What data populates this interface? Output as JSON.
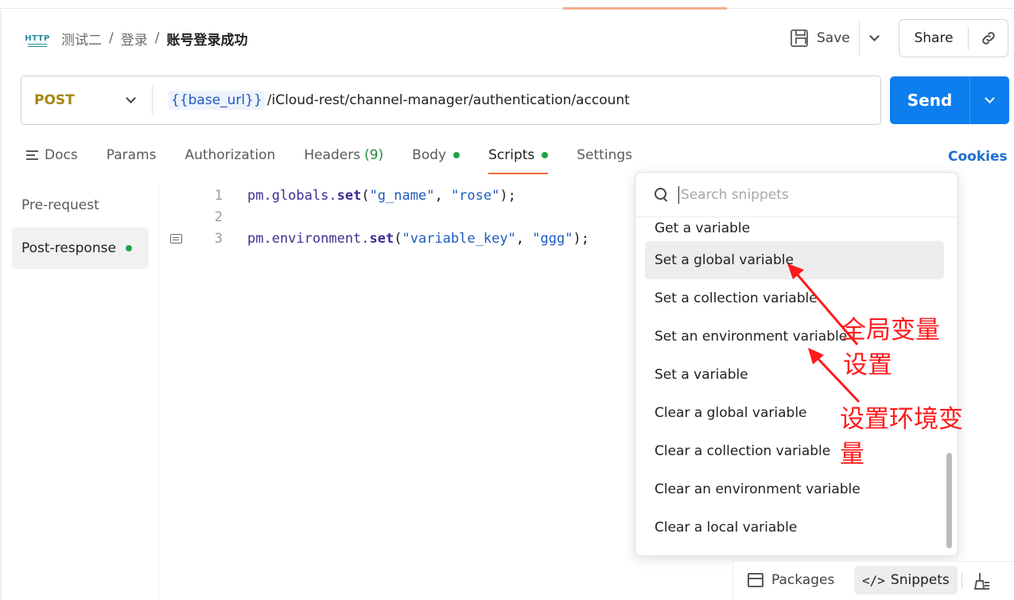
{
  "header": {
    "http_badge": "HTTP",
    "breadcrumb": [
      "测试二",
      "登录"
    ],
    "current": "账号登录成功",
    "save_label": "Save",
    "share_label": "Share"
  },
  "request": {
    "method": "POST",
    "url_variable": "{{base_url}}",
    "url_path": "/iCloud-rest/channel-manager/authentication/account",
    "send_label": "Send"
  },
  "tabs": [
    {
      "label": "Docs"
    },
    {
      "label": "Params"
    },
    {
      "label": "Authorization"
    },
    {
      "label": "Headers",
      "count": "(9)"
    },
    {
      "label": "Body",
      "dot": true
    },
    {
      "label": "Scripts",
      "dot": true,
      "active": true
    },
    {
      "label": "Settings"
    }
  ],
  "cookies_label": "Cookies",
  "script_nav": {
    "pre": "Pre-request",
    "post": "Post-response"
  },
  "editor": {
    "lines": [
      {
        "num": "1",
        "obj": "pm.globals.",
        "fn": "set",
        "open": "(",
        "s1": "\"g_name\"",
        "sep": ", ",
        "s2": "\"rose\"",
        "close": ");"
      },
      {
        "num": "2"
      },
      {
        "num": "3",
        "obj": "pm.environment.",
        "fn": "set",
        "open": "(",
        "s1": "\"variable_key\"",
        "sep": ", ",
        "s2": "\"ggg\"",
        "close": ");"
      }
    ]
  },
  "snippets": {
    "placeholder": "Search snippets",
    "items": [
      "Get a variable",
      "Set a global variable",
      "Set a collection variable",
      "Set an environment variable",
      "Set a variable",
      "Clear a global variable",
      "Clear a collection variable",
      "Clear an environment variable",
      "Clear a local variable"
    ]
  },
  "annotations": {
    "global_line1": "全局变量",
    "global_line2": "设置",
    "env_line1": "设置环境变",
    "env_line2": "量",
    "color": "#ff1a1a"
  },
  "bottom_bar": {
    "packages": "Packages",
    "snippets": "Snippets"
  },
  "colors": {
    "send": "#0c7eed",
    "method": "#a4870e",
    "active_tab_underline": "#f26b3a",
    "status_dot": "#1fa34a",
    "cookies": "#1a6fcf"
  }
}
